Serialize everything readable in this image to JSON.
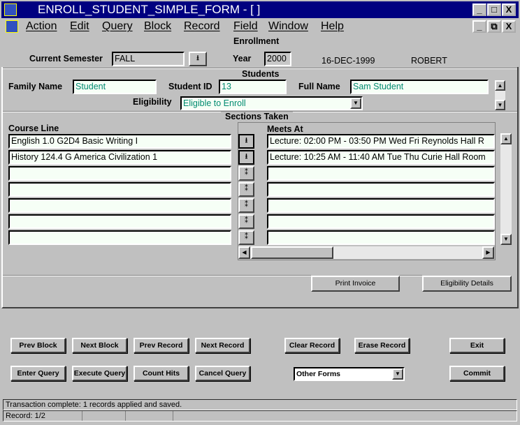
{
  "window": {
    "title": "ENROLL_STUDENT_SIMPLE_FORM - [ ]"
  },
  "menu": [
    "Action",
    "Edit",
    "Query",
    "Block",
    "Record",
    "Field",
    "Window",
    "Help"
  ],
  "enrollment": {
    "heading": "Enrollment",
    "semester_label": "Current Semester",
    "semester_value": "FALL",
    "year_label": "Year",
    "year_value": "2000",
    "date": "16-DEC-1999",
    "user": "ROBERT"
  },
  "students": {
    "heading": "Students",
    "family_name_label": "Family Name",
    "family_name": "Student",
    "student_id_label": "Student ID",
    "student_id": "13",
    "full_name_label": "Full Name",
    "full_name": "Sam  Student",
    "eligibility_label": "Eligibility",
    "eligibility": "Eligible to Enroll"
  },
  "sections": {
    "heading": "Sections Taken",
    "course_line_label": "Course Line",
    "meets_at_label": "Meets At",
    "rows": [
      {
        "course": "English 1.0 G2D4 Basic Writing I",
        "meets": "Lecture: 02:00 PM - 03:50 PM Wed Fri  Reynolds Hall R"
      },
      {
        "course": "History 124.4 G America Civilization 1",
        "meets": "Lecture: 10:25 AM - 11:40 AM Tue Thu  Curie Hall Room"
      },
      {
        "course": "",
        "meets": ""
      },
      {
        "course": "",
        "meets": ""
      },
      {
        "course": "",
        "meets": ""
      },
      {
        "course": "",
        "meets": ""
      },
      {
        "course": "",
        "meets": ""
      }
    ]
  },
  "tabs": {
    "print_invoice": "Print Invoice",
    "eligibility_details": "Eligibility Details"
  },
  "buttons": {
    "prev_block": "Prev Block",
    "next_block": "Next Block",
    "prev_record": "Prev Record",
    "next_record": "Next Record",
    "clear_record": "Clear Record",
    "erase_record": "Erase Record",
    "exit": "Exit",
    "enter_query": "Enter Query",
    "execute_query": "Execute Query",
    "count_hits": "Count Hits",
    "cancel_query": "Cancel Query",
    "other_forms": "Other Forms",
    "commit": "Commit"
  },
  "status": {
    "message": "Transaction complete: 1 records applied and saved.",
    "record": "Record: 1/2"
  }
}
